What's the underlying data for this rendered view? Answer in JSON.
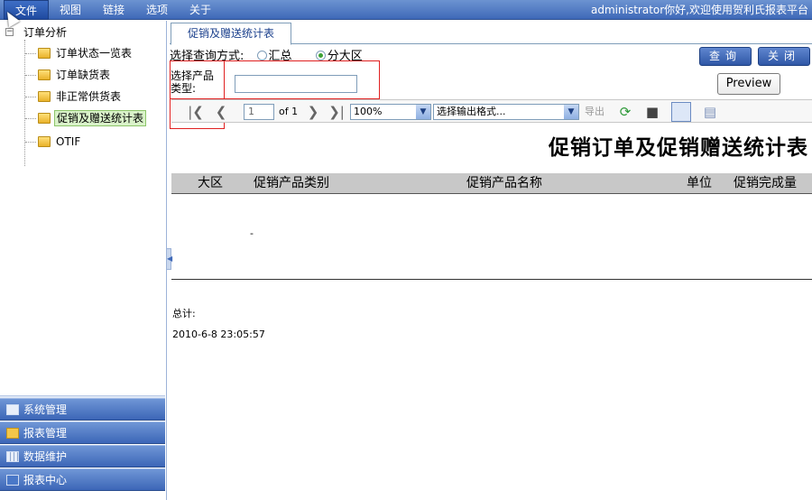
{
  "menu": {
    "items": [
      "文件",
      "视图",
      "链接",
      "选项",
      "关于"
    ],
    "welcome": "administrator你好,欢迎使用贺利氏报表平台"
  },
  "sidebar": {
    "root_label": "订单分析",
    "root_toggle": "−",
    "nodes": [
      "订单状态一览表",
      "订单缺货表",
      "非正常供货表",
      "促销及赠送统计表",
      "OTIF"
    ],
    "selected_index": 3,
    "panels": [
      "系统管理",
      "报表管理",
      "数据维护",
      "报表中心"
    ]
  },
  "tab": {
    "label": "促销及赠送统计表"
  },
  "query": {
    "mode_label": "选择查询方式:",
    "option_summary": "汇总",
    "option_region": "分大区",
    "selected": "分大区",
    "product_label_line1": "选择产品",
    "product_label_line2": "类型:",
    "product_value": "",
    "search_button": "查询",
    "close_button": "关闭",
    "preview_button": "Preview"
  },
  "toolbar": {
    "page_value": "1",
    "of_label": "of 1",
    "zoom": "100%",
    "format_placeholder": "选择输出格式...",
    "export_label": "导出"
  },
  "report": {
    "title": "促销订单及促销赠送统计表",
    "columns": [
      "大区",
      "促销产品类别",
      "促销产品名称",
      "单位",
      "促销完成量"
    ],
    "cell_dash": "-",
    "total_label": "总计:",
    "timestamp": "2010-6-8 23:05:57"
  },
  "colors": {
    "menubar": "#3f69b8",
    "selected_node_bg": "#d9f2c9",
    "highlight_box": "#e02020",
    "header_gray": "#c8c8c8"
  }
}
